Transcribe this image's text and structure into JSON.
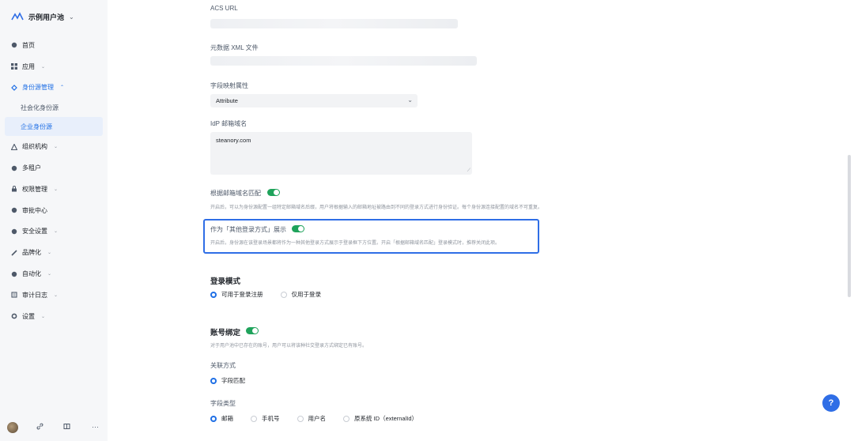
{
  "sidebar": {
    "app_name": "示例用户池",
    "items": [
      {
        "label": "首页",
        "icon": "home-icon"
      },
      {
        "label": "应用",
        "icon": "grid-icon",
        "arrow": "⌄"
      },
      {
        "label": "身份源管理",
        "icon": "identity-icon",
        "arrow": "⌃"
      },
      {
        "label": "组织机构",
        "icon": "org-icon",
        "arrow": "⌄"
      },
      {
        "label": "多租户",
        "icon": "tenant-icon"
      },
      {
        "label": "权限管理",
        "icon": "permission-icon",
        "arrow": "⌄"
      },
      {
        "label": "审批中心",
        "icon": "approval-icon"
      },
      {
        "label": "安全设置",
        "icon": "shield-icon",
        "arrow": "⌄"
      },
      {
        "label": "品牌化",
        "icon": "brand-icon",
        "arrow": "⌄"
      },
      {
        "label": "自动化",
        "icon": "automation-icon",
        "arrow": "⌄"
      },
      {
        "label": "审计日志",
        "icon": "audit-icon",
        "arrow": "⌄"
      },
      {
        "label": "设置",
        "icon": "gear-icon",
        "arrow": "⌄"
      }
    ],
    "sub_items": [
      "社会化身份源",
      "企业身份源"
    ]
  },
  "form": {
    "acs_label": "ACS URL",
    "metadata_label": "元数据 XML 文件",
    "mapping_label": "字段映射属性",
    "mapping_value": "Attribute",
    "idp_domain_label": "IdP 邮箱域名",
    "idp_domain_value": "steanory.com",
    "match_label": "根据邮箱域名匹配",
    "match_hint": "开启后，可以为身份源配置一组特定邮箱域名后缀，用户将根据输入的邮箱地址被路由到不同的登录方式进行身份验证。每个身份源连接配置的域名不可重复。",
    "other_login_label": "作为「其他登录方式」展示",
    "other_login_hint": "开启后，身份源在该登录场景都将作为一种其他登录方式展示于登录框下方位置。开启「根据邮箱域名匹配」登录模式时，推荐关闭此项。"
  },
  "login_mode": {
    "title": "登录模式",
    "options": [
      "可用于登录注册",
      "仅用于登录"
    ],
    "selected": "可用于登录注册"
  },
  "account_binding": {
    "title": "账号绑定",
    "hint": "对于用户池中已存在的账号，用户可以将该种社交登录方式绑定已有账号。",
    "link_label": "关联方式",
    "link_option": "字段匹配",
    "field_type_label": "字段类型",
    "field_types": [
      "邮箱",
      "手机号",
      "用户名",
      "原系统 ID（externalId）"
    ],
    "selected_field": "邮箱"
  },
  "footer": {
    "help": "?"
  },
  "colors": {
    "accent": "#1f6fe5",
    "toggle_on": "#1fa35b",
    "highlight_border": "#2f6ee6"
  }
}
